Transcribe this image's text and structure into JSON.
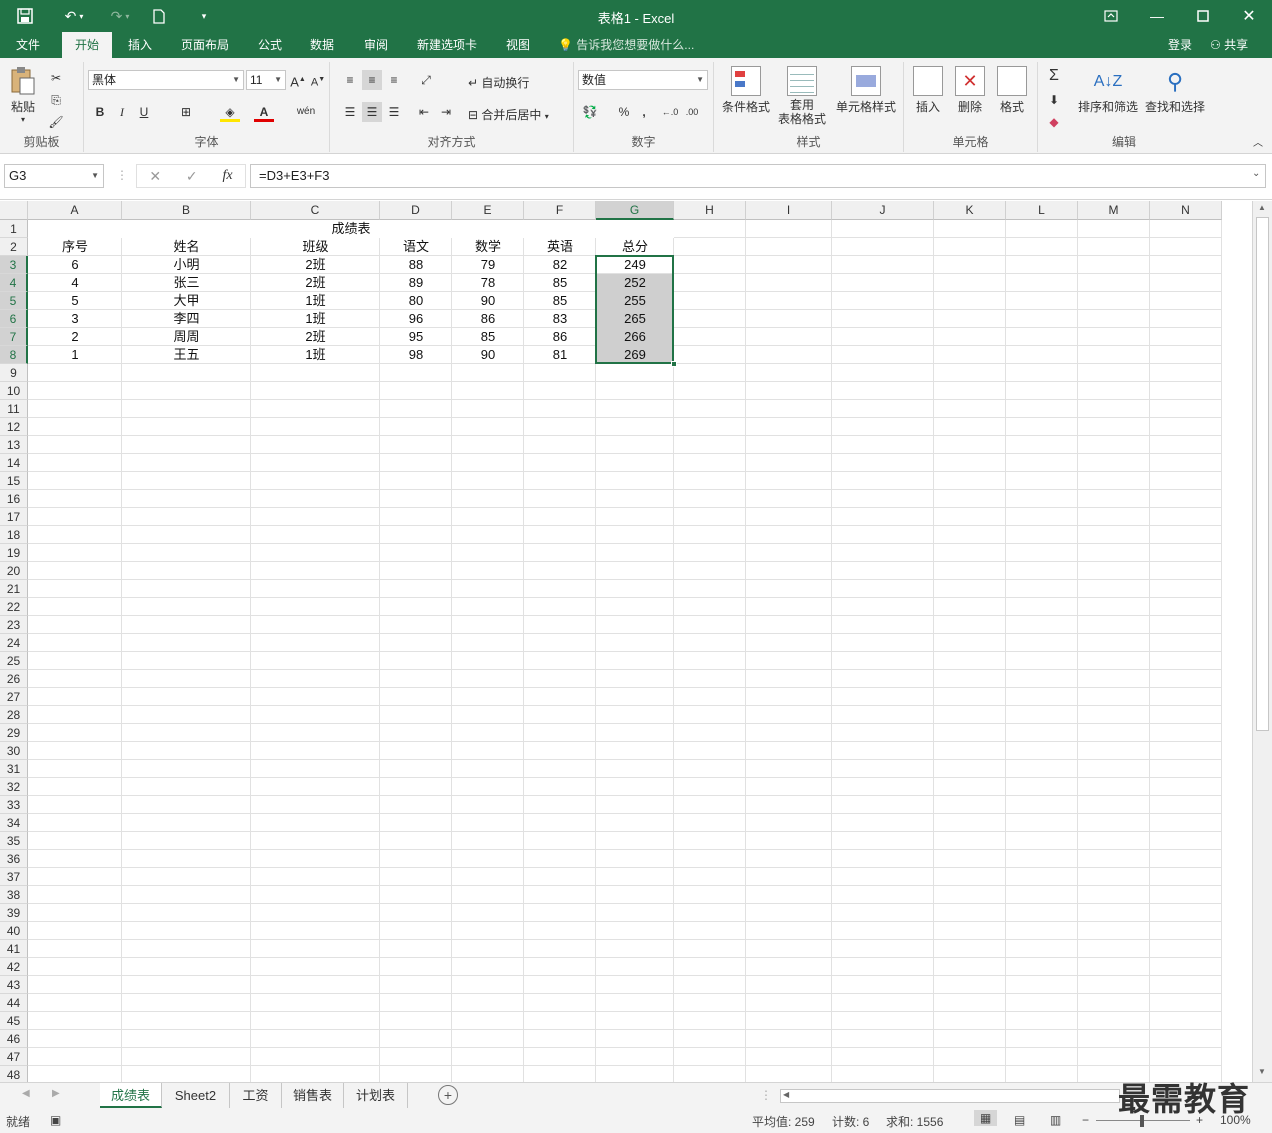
{
  "window": {
    "title": "表格1 - Excel"
  },
  "ribbon_tabs": [
    "文件",
    "开始",
    "插入",
    "页面布局",
    "公式",
    "数据",
    "审阅",
    "新建选项卡",
    "视图"
  ],
  "tell_me": "告诉我您想要做什么...",
  "account": {
    "login": "登录",
    "share": "共享"
  },
  "ribbon": {
    "clipboard": {
      "paste": "粘贴",
      "label": "剪贴板"
    },
    "font": {
      "name": "黑体",
      "size": "11",
      "bold": "B",
      "italic": "I",
      "underline": "U",
      "label": "字体"
    },
    "alignment": {
      "wrap": "自动换行",
      "merge": "合并后居中",
      "label": "对齐方式"
    },
    "number": {
      "format": "数值",
      "percent": "%",
      "label": "数字"
    },
    "styles": {
      "conditional": "条件格式",
      "table_format_1": "套用",
      "table_format_2": "表格格式",
      "cell_styles": "单元格样式",
      "label": "样式"
    },
    "cells": {
      "insert": "插入",
      "delete": "删除",
      "format": "格式",
      "label": "单元格"
    },
    "editing": {
      "sort": "排序和筛选",
      "find": "查找和选择",
      "label": "编辑"
    }
  },
  "formula_bar": {
    "name_box": "G3",
    "formula": "=D3+E3+F3",
    "fx": "fx"
  },
  "columns": [
    "A",
    "B",
    "C",
    "D",
    "E",
    "F",
    "G",
    "H",
    "I",
    "J",
    "K",
    "L",
    "M",
    "N"
  ],
  "sheet": {
    "title": "成绩表",
    "headers": [
      "序号",
      "姓名",
      "班级",
      "语文",
      "数学",
      "英语",
      "总分"
    ],
    "rows": [
      [
        "6",
        "小明",
        "2班",
        "88",
        "79",
        "82",
        "249"
      ],
      [
        "4",
        "张三",
        "2班",
        "89",
        "78",
        "85",
        "252"
      ],
      [
        "5",
        "大甲",
        "1班",
        "80",
        "90",
        "85",
        "255"
      ],
      [
        "3",
        "李四",
        "1班",
        "96",
        "86",
        "83",
        "265"
      ],
      [
        "2",
        "周周",
        "2班",
        "95",
        "85",
        "86",
        "266"
      ],
      [
        "1",
        "王五",
        "1班",
        "98",
        "90",
        "81",
        "269"
      ]
    ],
    "row_count": 48
  },
  "sheet_tabs": [
    "成绩表",
    "Sheet2",
    "工资",
    "销售表",
    "计划表"
  ],
  "status": {
    "ready": "就绪",
    "average": "平均值: 259",
    "count": "计数: 6",
    "sum": "求和: 1556",
    "zoom": "100%"
  },
  "watermark": "最需教育"
}
